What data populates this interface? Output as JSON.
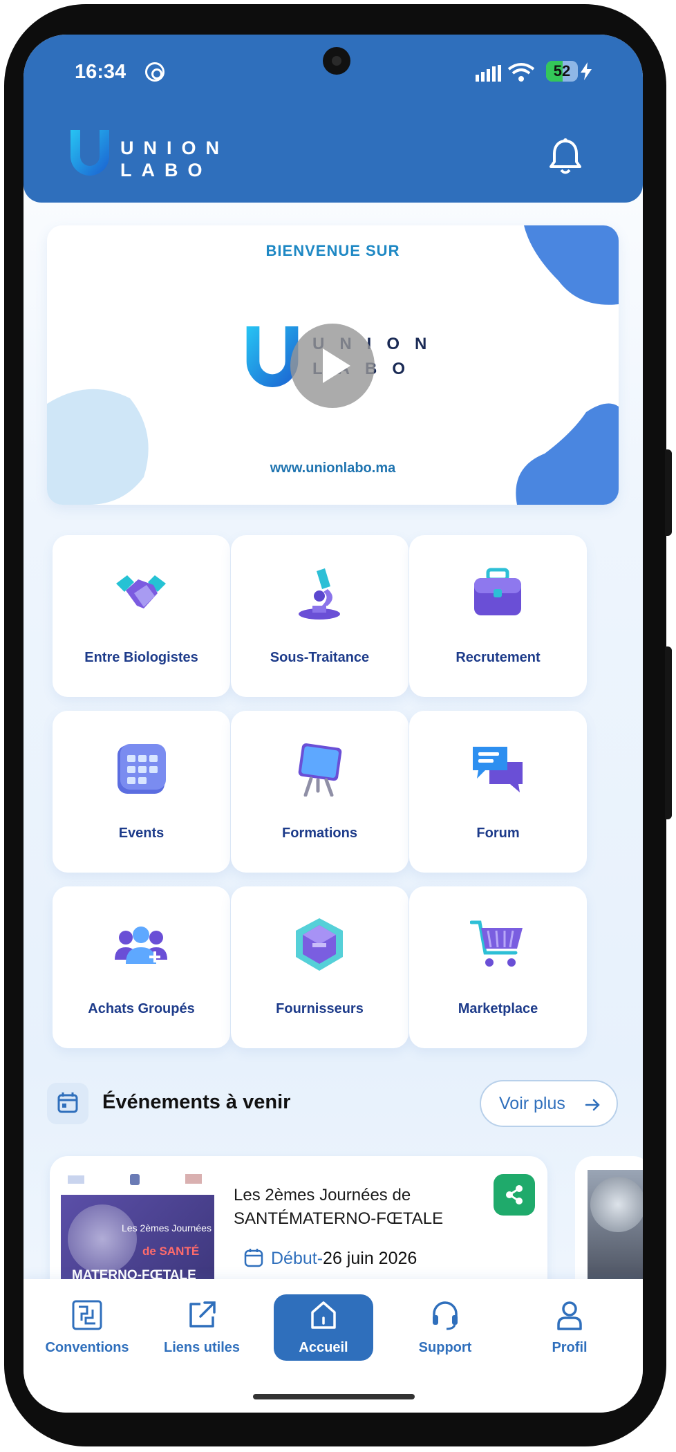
{
  "status_bar": {
    "time": "16:34",
    "battery": "52"
  },
  "header": {
    "logo_line1": "UNION",
    "logo_line2": "LABO"
  },
  "banner": {
    "title": "BIENVENUE SUR",
    "logo_line1": "UNION",
    "logo_line2": "LABO",
    "url": "www.unionlabo.ma"
  },
  "tiles": [
    {
      "label": "Entre Biologistes",
      "icon": "handshake-icon"
    },
    {
      "label": "Sous-Traitance",
      "icon": "microscope-icon"
    },
    {
      "label": "Recrutement",
      "icon": "briefcase-icon"
    },
    {
      "label": "Events",
      "icon": "calendar-icon"
    },
    {
      "label": "Formations",
      "icon": "easel-board-icon"
    },
    {
      "label": "Forum",
      "icon": "chat-bubbles-icon"
    },
    {
      "label": "Achats Groupés",
      "icon": "group-users-icon"
    },
    {
      "label": "Fournisseurs",
      "icon": "package-box-icon"
    },
    {
      "label": "Marketplace",
      "icon": "shopping-cart-icon"
    }
  ],
  "events": {
    "title": "Événements à venir",
    "see_more": "Voir plus",
    "cards": [
      {
        "title": "Les 2èmes Journées de SANTÉMATERNO-FŒTALE",
        "date_label": "Début-",
        "date": "26 juin 2026",
        "poster": {
          "line1": "Les 2èmes Journées",
          "line2": "de SANTÉ",
          "line3": "MATERNO-FŒTALE"
        }
      }
    ]
  },
  "nav": {
    "items": [
      {
        "label": "Conventions",
        "icon": "conventions-icon"
      },
      {
        "label": "Liens utiles",
        "icon": "external-link-icon"
      },
      {
        "label": "Accueil",
        "icon": "home-icon",
        "active": true
      },
      {
        "label": "Support",
        "icon": "headset-icon"
      },
      {
        "label": "Profil",
        "icon": "user-icon"
      }
    ]
  },
  "colors": {
    "primary": "#2f6fbc",
    "tile_text": "#1d3b8a",
    "share": "#1faa6b"
  }
}
